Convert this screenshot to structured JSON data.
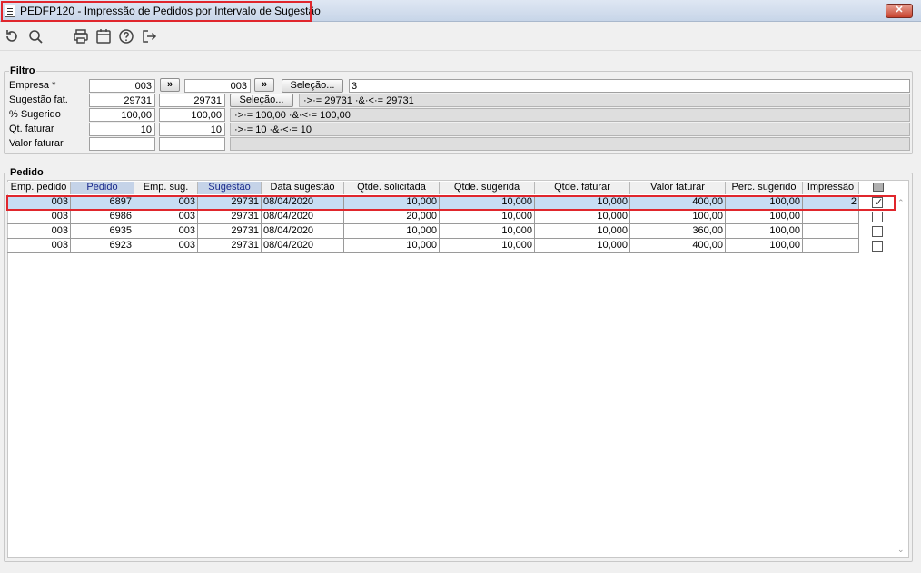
{
  "window": {
    "title": "PEDFP120 - Impressão de Pedidos por Intervalo de Sugestão",
    "close_label": "✕"
  },
  "toolbar": {
    "icons": [
      "refresh-icon",
      "search-icon",
      "print-icon",
      "calendar-icon",
      "help-icon",
      "exit-icon"
    ]
  },
  "filtro": {
    "legend": "Filtro",
    "empresa": {
      "label": "Empresa *",
      "from": "003",
      "to": "003",
      "btn_from": "»",
      "btn_to": "»",
      "selecao": "Seleção...",
      "value": "3"
    },
    "sugestao": {
      "label": "Sugestão fat.",
      "from": "29731",
      "to": "29731",
      "selecao": "Seleção...",
      "expr": "·>·= 29731 ·&·<·= 29731"
    },
    "perc": {
      "label": "% Sugerido",
      "from": "100,00",
      "to": "100,00",
      "expr": "·>·= 100,00 ·&·<·= 100,00"
    },
    "qt": {
      "label": "Qt. faturar",
      "from": "10",
      "to": "10",
      "expr": "·>·= 10 ·&·<·= 10"
    },
    "valor": {
      "label": "Valor faturar",
      "from": "",
      "to": "",
      "expr": ""
    }
  },
  "pedido": {
    "legend": "Pedido",
    "columns": [
      "Emp. pedido",
      "Pedido",
      "Emp. sug.",
      "Sugestão",
      "Data sugestão",
      "Qtde. solicitada",
      "Qtde. sugerida",
      "Qtde. faturar",
      "Valor faturar",
      "Perc. sugerido",
      "Impressão"
    ],
    "rows": [
      {
        "emp_pedido": "003",
        "pedido": "6897",
        "emp_sug": "003",
        "sugestao": "29731",
        "data": "08/04/2020",
        "qt_sol": "10,000",
        "qt_sug": "10,000",
        "qt_fat": "10,000",
        "valor": "400,00",
        "perc": "100,00",
        "impressao": "2",
        "checked": true
      },
      {
        "emp_pedido": "003",
        "pedido": "6986",
        "emp_sug": "003",
        "sugestao": "29731",
        "data": "08/04/2020",
        "qt_sol": "20,000",
        "qt_sug": "10,000",
        "qt_fat": "10,000",
        "valor": "100,00",
        "perc": "100,00",
        "impressao": "",
        "checked": false
      },
      {
        "emp_pedido": "003",
        "pedido": "6935",
        "emp_sug": "003",
        "sugestao": "29731",
        "data": "08/04/2020",
        "qt_sol": "10,000",
        "qt_sug": "10,000",
        "qt_fat": "10,000",
        "valor": "360,00",
        "perc": "100,00",
        "impressao": "",
        "checked": false
      },
      {
        "emp_pedido": "003",
        "pedido": "6923",
        "emp_sug": "003",
        "sugestao": "29731",
        "data": "08/04/2020",
        "qt_sol": "10,000",
        "qt_sug": "10,000",
        "qt_fat": "10,000",
        "valor": "400,00",
        "perc": "100,00",
        "impressao": "",
        "checked": false
      }
    ]
  },
  "colors": {
    "highlight": "#e0262c",
    "selected_row": "#c7ddf3",
    "sorted_header": "#c5d3e8"
  }
}
